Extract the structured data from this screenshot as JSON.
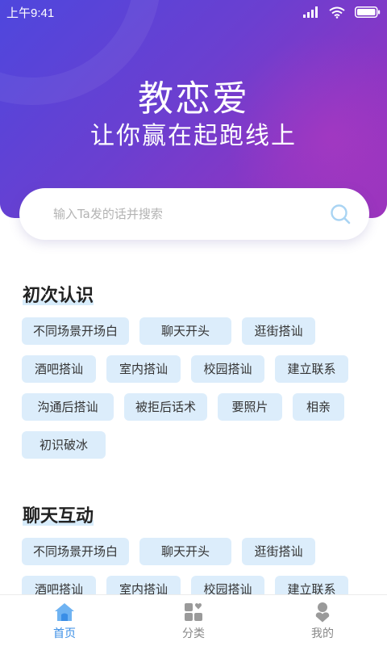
{
  "status_bar": {
    "time": "上午9:41"
  },
  "hero": {
    "title": "教恋爱",
    "subtitle": "让你赢在起跑线上"
  },
  "search": {
    "placeholder": "输入Ta发的话并搜索",
    "value": ""
  },
  "sections": [
    {
      "title": "初次认识",
      "tags": [
        "不同场景开场白",
        "聊天开头",
        "逛街搭讪",
        "酒吧搭讪",
        "室内搭讪",
        "校园搭讪",
        "建立联系",
        "沟通后搭讪",
        "被拒后话术",
        "要照片",
        "相亲",
        "初识破冰"
      ]
    },
    {
      "title": "聊天互动",
      "tags": [
        "不同场景开场白",
        "聊天开头",
        "逛街搭讪",
        "酒吧搭讪",
        "室内搭讪",
        "校园搭讪",
        "建立联系"
      ]
    }
  ],
  "tabbar": [
    {
      "label": "首页",
      "icon": "home-icon",
      "active": true
    },
    {
      "label": "分类",
      "icon": "category-icon",
      "active": false
    },
    {
      "label": "我的",
      "icon": "profile-icon",
      "active": false
    }
  ],
  "colors": {
    "accent": "#3a8ee6",
    "tag_bg": "#dcedfb",
    "header_start": "#4e47dd",
    "header_end": "#9b34bd"
  }
}
